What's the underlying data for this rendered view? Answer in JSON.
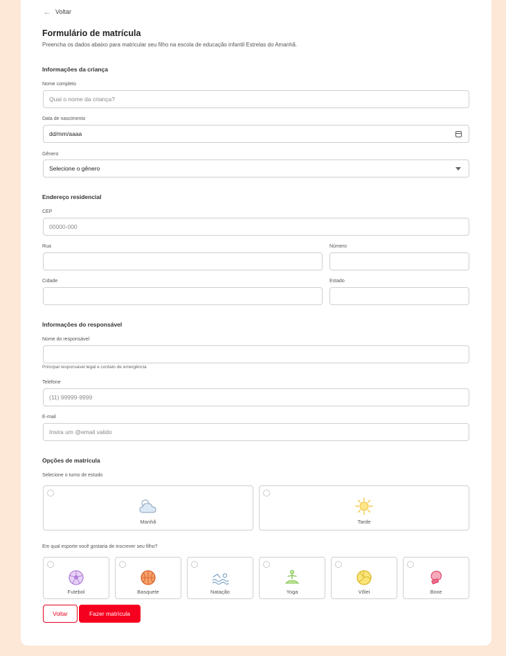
{
  "header": {
    "back_label": "Voltar",
    "title": "Formulário de matrícula",
    "subtitle": "Preencha os dados abaixo para matricular seu filho na escola de educação infantil Estrelas do Amanhã."
  },
  "child": {
    "section": "Informações da criança",
    "name_label": "Nome completo",
    "name_placeholder": "Qual o nome da criança?",
    "birth_label": "Data de nascimento",
    "birth_value": "dd/mm/aaaa",
    "gender_label": "Gênero",
    "gender_value": "Selecione o gênero"
  },
  "address": {
    "section": "Endereço residencial",
    "cep_label": "CEP",
    "cep_placeholder": "00000-000",
    "street_label": "Rua",
    "number_label": "Número",
    "city_label": "Cidade",
    "state_label": "Estado"
  },
  "guardian": {
    "section": "Informações do responsável",
    "name_label": "Nome do responsável",
    "name_help": "Principal responsável legal e contato de emergência",
    "phone_label": "Telefone",
    "phone_placeholder": "(11) 99999-9999",
    "email_label": "E-mail",
    "email_placeholder": "Insira um @email valido"
  },
  "enrollment": {
    "section": "Opções de matrícula",
    "shift_label": "Selecione o turno de estudo",
    "shifts": [
      {
        "label": "Manhã",
        "icon": "cloud-sun-icon"
      },
      {
        "label": "Tarde",
        "icon": "sun-icon"
      }
    ],
    "sport_label": "Em qual esporte você gostaria de inscrever seu filho?",
    "sports": [
      {
        "label": "Futebol",
        "icon": "soccer-ball-icon",
        "color": "#c89be8"
      },
      {
        "label": "Basquete",
        "icon": "basketball-icon",
        "color": "#f08a4b"
      },
      {
        "label": "Natação",
        "icon": "swimming-icon",
        "color": "#8fb4d9"
      },
      {
        "label": "Yoga",
        "icon": "yoga-icon",
        "color": "#9ad16d"
      },
      {
        "label": "Vôlei",
        "icon": "volleyball-icon",
        "color": "#f2d24a"
      },
      {
        "label": "Boxe",
        "icon": "boxing-glove-icon",
        "color": "#f06a8a"
      }
    ]
  },
  "actions": {
    "back_label": "Voltar",
    "submit_label": "Fazer matrícula"
  }
}
